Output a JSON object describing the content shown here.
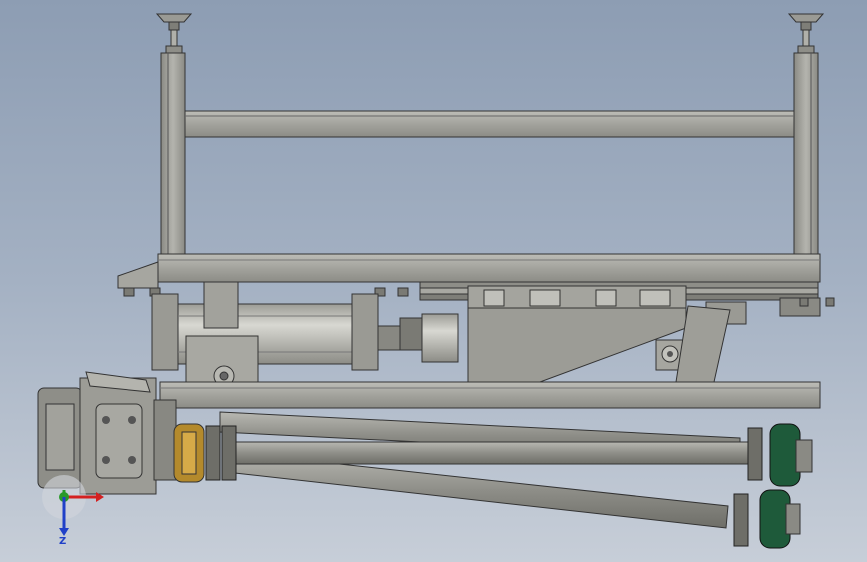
{
  "viewport": {
    "background_top": "#8d9db3",
    "background_bottom": "#c7ced8"
  },
  "model": {
    "frame_color": "#a9a9a2",
    "frame_dark": "#5e5e58",
    "sprocket_gold": "#b48a2c",
    "sprocket_green": "#1e5a3a"
  },
  "triad": {
    "z_label": "Z",
    "x_color": "#d42020",
    "y_color": "#2a9a2a",
    "z_color": "#2040c8"
  }
}
